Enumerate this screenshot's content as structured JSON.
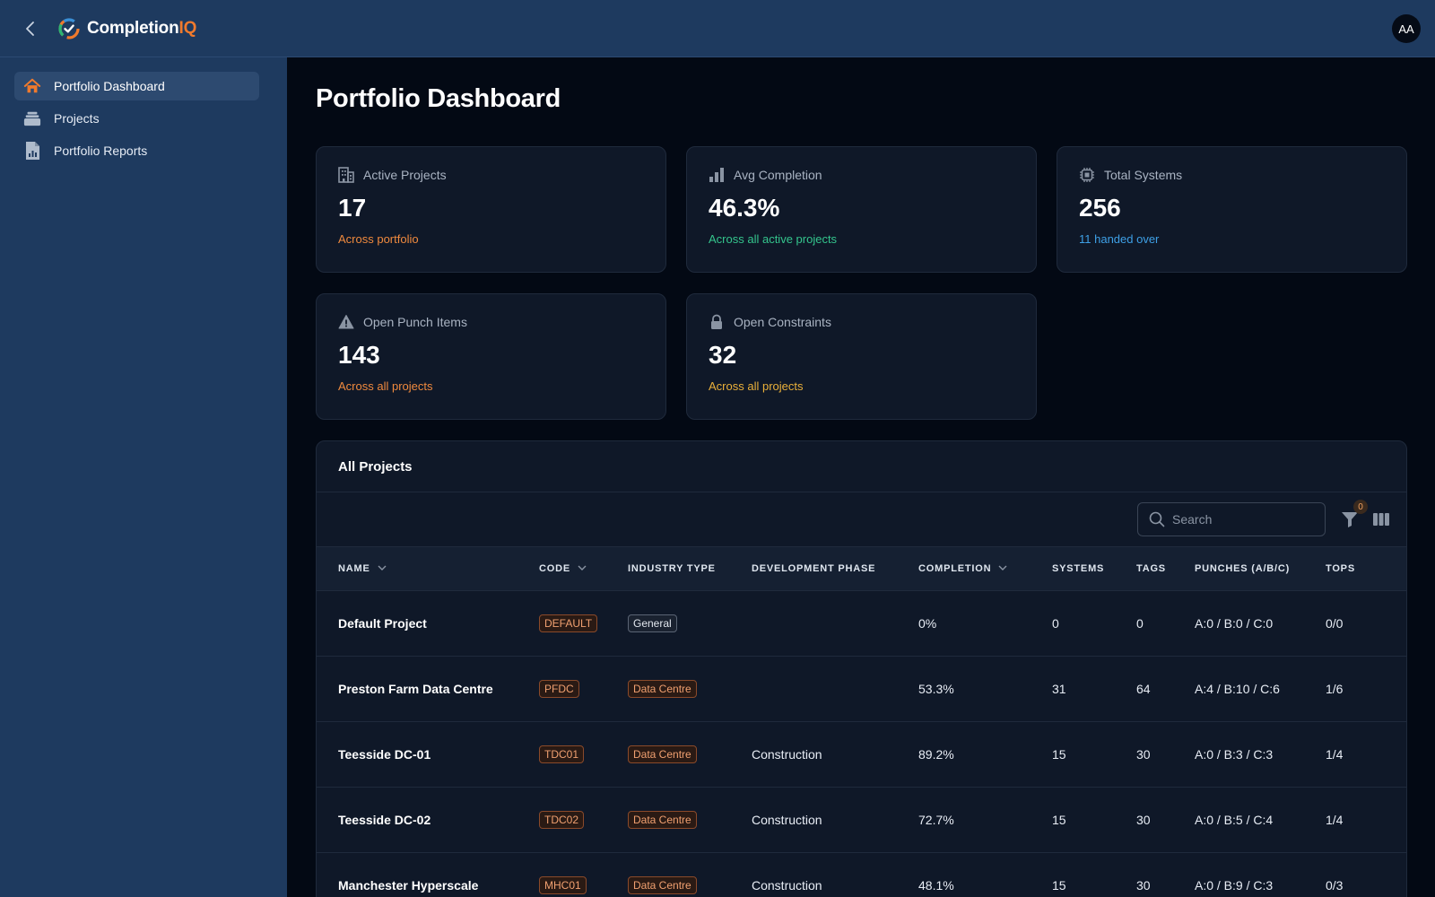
{
  "app": {
    "brand_main": "Completion",
    "brand_accent": "IQ",
    "avatar_initials": "AA"
  },
  "sidebar": {
    "items": [
      {
        "label": "Portfolio Dashboard",
        "icon": "home-icon",
        "active": true
      },
      {
        "label": "Projects",
        "icon": "stack-icon",
        "active": false
      },
      {
        "label": "Portfolio Reports",
        "icon": "report-icon",
        "active": false
      }
    ]
  },
  "page": {
    "title": "Portfolio Dashboard"
  },
  "stats": [
    {
      "label": "Active Projects",
      "value": "17",
      "sub": "Across portfolio",
      "icon": "building-icon",
      "sub_color": "#f08a3e"
    },
    {
      "label": "Avg Completion",
      "value": "46.3%",
      "sub": "Across all active projects",
      "icon": "bar-chart-icon",
      "sub_color": "#34c58d"
    },
    {
      "label": "Total Systems",
      "value": "256",
      "sub": "11 handed over",
      "icon": "chip-icon",
      "sub_color": "#3ea0e6"
    },
    {
      "label": "Open Punch Items",
      "value": "143",
      "sub": "Across all projects",
      "icon": "warning-icon",
      "sub_color": "#f08a3e"
    },
    {
      "label": "Open Constraints",
      "value": "32",
      "sub": "Across all projects",
      "icon": "lock-icon",
      "sub_color": "#eab03a"
    }
  ],
  "projects_table": {
    "title": "All Projects",
    "search_placeholder": "Search",
    "filter_count": "0",
    "columns": [
      "NAME",
      "CODE",
      "INDUSTRY TYPE",
      "DEVELOPMENT PHASE",
      "COMPLETION",
      "SYSTEMS",
      "TAGS",
      "PUNCHES (A/B/C)",
      "TOPS"
    ],
    "rows": [
      {
        "name": "Default Project",
        "code": "DEFAULT",
        "industry": "General",
        "phase": "",
        "completion": "0%",
        "systems": "0",
        "tags": "0",
        "punches": "A:0 / B:0 / C:0",
        "tops": "0/0"
      },
      {
        "name": "Preston Farm Data Centre",
        "code": "PFDC",
        "industry": "Data Centre",
        "phase": "",
        "completion": "53.3%",
        "systems": "31",
        "tags": "64",
        "punches": "A:4 / B:10 / C:6",
        "tops": "1/6"
      },
      {
        "name": "Teesside DC-01",
        "code": "TDC01",
        "industry": "Data Centre",
        "phase": "Construction",
        "completion": "89.2%",
        "systems": "15",
        "tags": "30",
        "punches": "A:0 / B:3 / C:3",
        "tops": "1/4"
      },
      {
        "name": "Teesside DC-02",
        "code": "TDC02",
        "industry": "Data Centre",
        "phase": "Construction",
        "completion": "72.7%",
        "systems": "15",
        "tags": "30",
        "punches": "A:0 / B:5 / C:4",
        "tops": "1/4"
      },
      {
        "name": "Manchester Hyperscale",
        "code": "MHC01",
        "industry": "Data Centre",
        "phase": "Construction",
        "completion": "48.1%",
        "systems": "15",
        "tags": "30",
        "punches": "A:0 / B:9 / C:3",
        "tops": "0/3"
      }
    ]
  },
  "colors": {
    "accent": "#f07a2d",
    "sidebar_bg": "#1e3a5f",
    "main_bg": "#030914",
    "card_bg": "#0f1828"
  }
}
